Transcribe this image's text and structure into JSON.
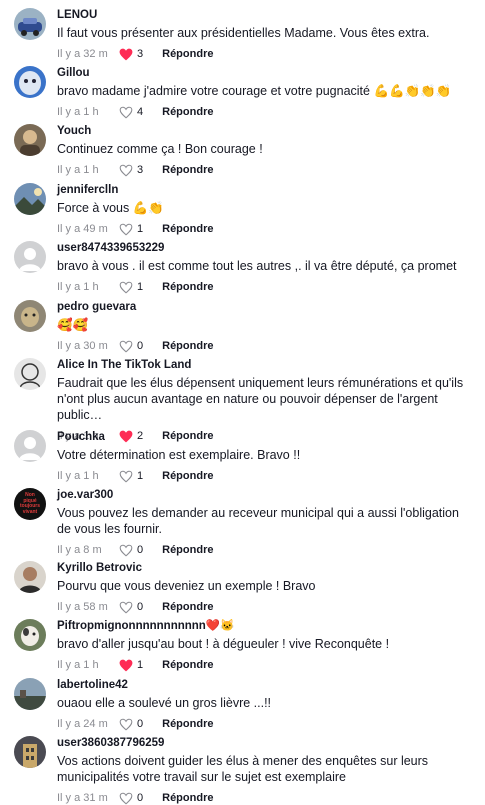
{
  "comments": [
    {
      "user": "LENOU",
      "text": "Il faut vous présenter aux présidentielles Madame. Vous êtes extra.",
      "time": "Il y a 32 m",
      "likes": "3",
      "liked": true,
      "reply": "Répondre",
      "avatar": "avatar-blue-car"
    },
    {
      "user": "Gillou",
      "text": "bravo madame j'admire votre courage et votre pugnacité 💪💪👏👏👏",
      "time": "Il y a 1 h",
      "likes": "4",
      "liked": false,
      "reply": "Répondre",
      "avatar": "avatar-blue-face"
    },
    {
      "user": "Youch",
      "text": "Continuez comme ça ! Bon courage !",
      "time": "Il y a 1 h",
      "likes": "3",
      "liked": false,
      "reply": "Répondre",
      "avatar": "avatar-photo"
    },
    {
      "user": "jenniferclln",
      "text": "Force à vous 💪👏",
      "time": "Il y a 49 m",
      "likes": "1",
      "liked": false,
      "reply": "Répondre",
      "avatar": "avatar-landscape"
    },
    {
      "user": "user8474339653229",
      "text": "bravo à vous . il est comme tout les autres ,. il va être député, ça promet",
      "time": "Il y a 1 h",
      "likes": "1",
      "liked": false,
      "reply": "Répondre",
      "avatar": "avatar-default"
    },
    {
      "user": "pedro guevara",
      "text": "🥰🥰",
      "time": "Il y a 30 m",
      "likes": "0",
      "liked": false,
      "reply": "Répondre",
      "avatar": "avatar-dog"
    },
    {
      "user": "Alice In The TikTok Land",
      "text": "Faudrait que les élus dépensent uniquement leurs rémunérations et qu'ils n'ont plus aucun avantage en nature ou pouvoir dépenser de l'argent public…",
      "time": "Il y a 1 h",
      "likes": "2",
      "liked": true,
      "reply": "Répondre",
      "avatar": "avatar-sketch"
    },
    {
      "user": "Pouchka",
      "text": "Votre détermination est exemplaire. Bravo !!",
      "time": "Il y a 1 h",
      "likes": "1",
      "liked": false,
      "reply": "Répondre",
      "avatar": "avatar-default"
    },
    {
      "user": "joe.var300",
      "text": "Vous pouvez les demander au receveur municipal qui a aussi l'obligation de vous les fournir.",
      "time": "Il y a 8 m",
      "likes": "0",
      "liked": false,
      "reply": "Répondre",
      "avatar": "avatar-black-text",
      "avatar_text": [
        "Non",
        "piqué",
        "toujours",
        "vivant"
      ]
    },
    {
      "user": "Kyrillo Betrovic",
      "text": "Pourvu que vous deveniez un exemple ! Bravo",
      "time": "Il y a 58 m",
      "likes": "0",
      "liked": false,
      "reply": "Répondre",
      "avatar": "avatar-man"
    },
    {
      "user": "Piftropmignonnnnnnnnnnn❤️🐱",
      "text": "bravo d'aller jusqu'au bout ! à dégueuler ! vive Reconquête !",
      "time": "Il y a 1 h",
      "likes": "1",
      "liked": true,
      "reply": "Répondre",
      "avatar": "avatar-dog2"
    },
    {
      "user": "labertoline42",
      "text": "ouaou elle a soulevé un gros lièvre ...!!",
      "time": "Il y a 24 m",
      "likes": "0",
      "liked": false,
      "reply": "Répondre",
      "avatar": "avatar-landscape2"
    },
    {
      "user": "user3860387796259",
      "text": "Vos actions doivent guider les élus à mener des enquêtes sur leurs municipalités votre travail sur le sujet est exemplaire",
      "time": "Il y a 31 m",
      "likes": "0",
      "liked": false,
      "reply": "Répondre",
      "avatar": "avatar-building"
    }
  ],
  "colors": {
    "liked": "#fe2c55",
    "meta": "#8a8b91",
    "text": "#161823"
  }
}
